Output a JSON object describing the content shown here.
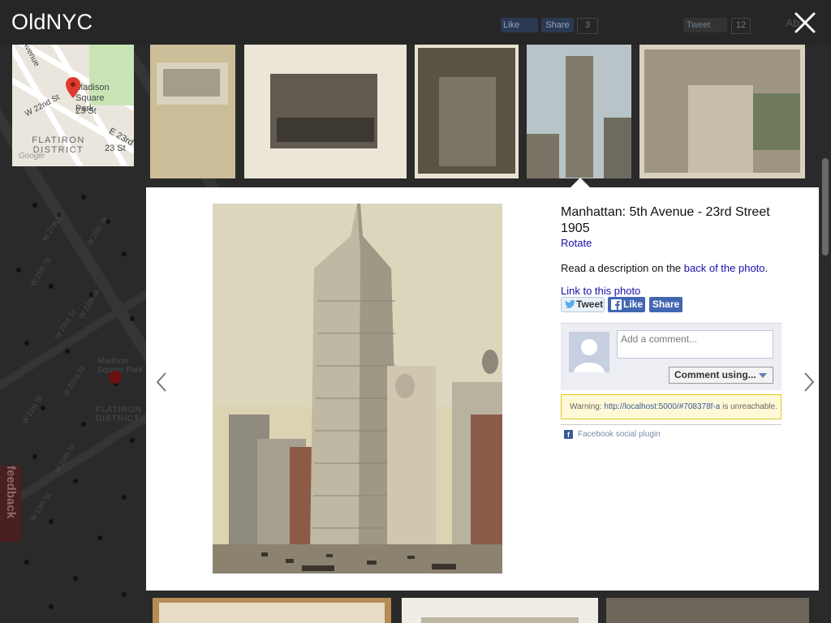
{
  "app": {
    "title": "OldNYC"
  },
  "top_social": {
    "like_label": "Like",
    "share_label": "Share",
    "share_count": "3",
    "tweet_label": "Tweet",
    "tweet_count": "12",
    "about_label": "Ab"
  },
  "minimap": {
    "labels": [
      "Madison Square Park",
      "W 22nd St",
      "23 St",
      "E 23rd",
      "FLATIRON DISTRICT",
      "23 St",
      "Avenue"
    ],
    "attribution": "Google"
  },
  "background_map": {
    "street_labels": [
      "W 27th St",
      "W 26th St",
      "W 25th St",
      "W 24th St",
      "W 23rd St",
      "W 22nd St",
      "W 21st St",
      "W 20th St",
      "W 19th St"
    ],
    "place_labels": [
      "Madison Square Park",
      "FLATIRON DISTRICT"
    ]
  },
  "thumbnails": [
    {
      "name": "thumb-1"
    },
    {
      "name": "thumb-2"
    },
    {
      "name": "thumb-3"
    },
    {
      "name": "thumb-4-selected"
    },
    {
      "name": "thumb-5"
    }
  ],
  "detail": {
    "title": "Manhattan: 5th Avenue - 23rd Street",
    "year": "1905",
    "rotate_label": "Rotate",
    "description_prefix": "Read a description on the ",
    "description_link": "back of the photo",
    "description_suffix": ".",
    "permalink_label": "Link to this photo",
    "tweet_label": "Tweet",
    "like_label": "Like",
    "share_label": "Share"
  },
  "comments": {
    "placeholder": "Add a comment...",
    "comment_using_label": "Comment using...",
    "warning_prefix": "Warning: ",
    "warning_url": "http://localhost:5000/#708378f-a",
    "warning_suffix": " is unreachable.",
    "plugin_label": "Facebook social plugin"
  },
  "feedback_label": "feedback",
  "colors": {
    "facebook_blue": "#4267b2",
    "link_blue": "#1a0dab",
    "warning_bg": "#fff9d7"
  },
  "icons": [
    "close-icon",
    "prev-arrow-icon",
    "next-arrow-icon",
    "twitter-bird-icon",
    "facebook-f-icon",
    "map-pin-icon",
    "dropdown-caret-icon"
  ]
}
